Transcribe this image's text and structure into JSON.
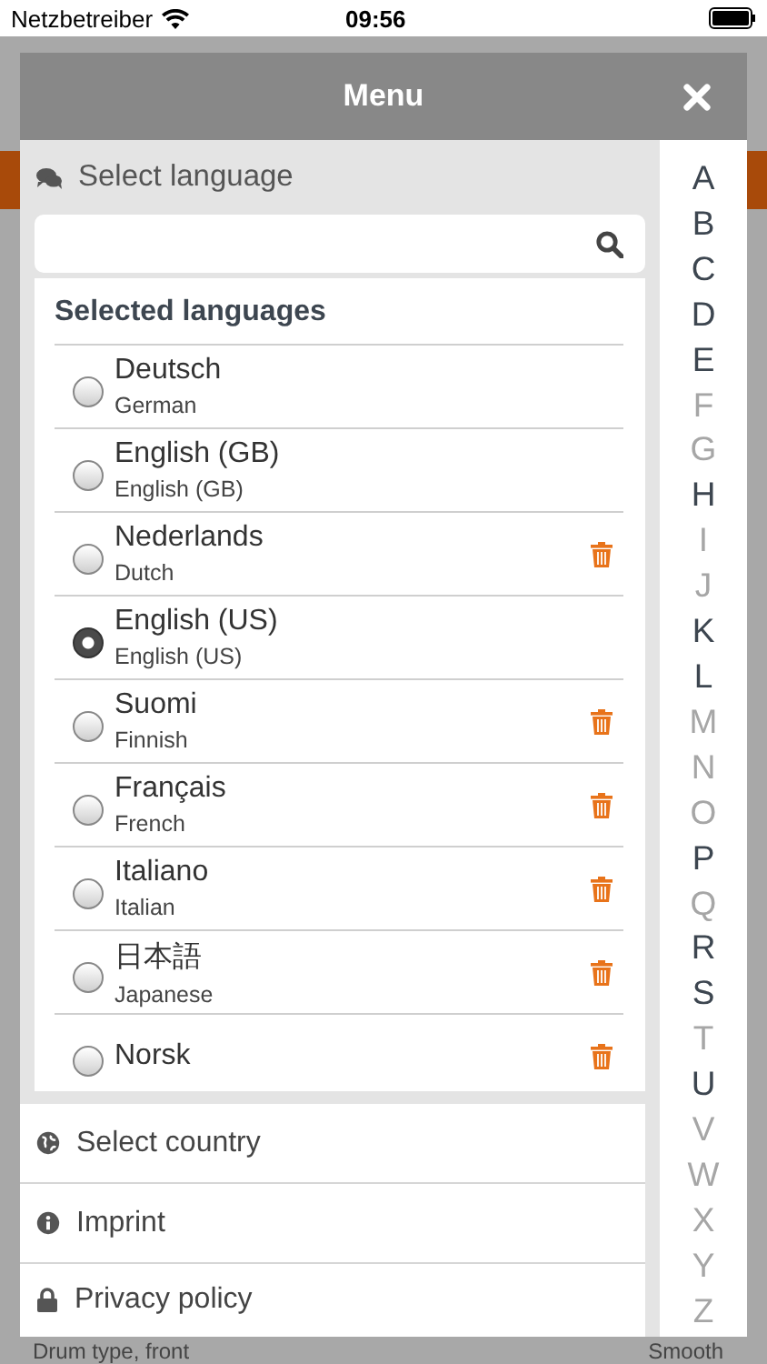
{
  "status_bar": {
    "carrier": "Netzbetreiber",
    "time": "09:56"
  },
  "background": {
    "rows": [
      {
        "label": "Drum type, front",
        "value": "Smooth"
      }
    ]
  },
  "menu": {
    "title": "Menu",
    "language_section": {
      "title": "Select language",
      "selected_heading": "Selected languages",
      "languages": [
        {
          "name": "Deutsch",
          "english": "German",
          "selected": false,
          "deletable": false
        },
        {
          "name": "English (GB)",
          "english": "English (GB)",
          "selected": false,
          "deletable": false
        },
        {
          "name": "Nederlands",
          "english": "Dutch",
          "selected": false,
          "deletable": true
        },
        {
          "name": "English (US)",
          "english": "English (US)",
          "selected": true,
          "deletable": false
        },
        {
          "name": "Suomi",
          "english": "Finnish",
          "selected": false,
          "deletable": true
        },
        {
          "name": "Français",
          "english": "French",
          "selected": false,
          "deletable": true
        },
        {
          "name": "Italiano",
          "english": "Italian",
          "selected": false,
          "deletable": true
        },
        {
          "name": "日本語",
          "english": "Japanese",
          "selected": false,
          "deletable": true
        },
        {
          "name": "Norsk",
          "selected": false,
          "deletable": true
        }
      ]
    },
    "nav_items": [
      {
        "label": "Select country",
        "kind": "globe"
      },
      {
        "label": "Imprint",
        "kind": "info"
      },
      {
        "label": "Privacy policy",
        "kind": "lock"
      }
    ],
    "alphabet": [
      {
        "letter": "A",
        "enabled": true
      },
      {
        "letter": "B",
        "enabled": true
      },
      {
        "letter": "C",
        "enabled": true
      },
      {
        "letter": "D",
        "enabled": true
      },
      {
        "letter": "E",
        "enabled": true
      },
      {
        "letter": "F",
        "enabled": false
      },
      {
        "letter": "G",
        "enabled": false
      },
      {
        "letter": "H",
        "enabled": true
      },
      {
        "letter": "I",
        "enabled": false
      },
      {
        "letter": "J",
        "enabled": false
      },
      {
        "letter": "K",
        "enabled": true
      },
      {
        "letter": "L",
        "enabled": true
      },
      {
        "letter": "M",
        "enabled": false
      },
      {
        "letter": "N",
        "enabled": false
      },
      {
        "letter": "O",
        "enabled": false
      },
      {
        "letter": "P",
        "enabled": true
      },
      {
        "letter": "Q",
        "enabled": false
      },
      {
        "letter": "R",
        "enabled": true
      },
      {
        "letter": "S",
        "enabled": true
      },
      {
        "letter": "T",
        "enabled": false
      },
      {
        "letter": "U",
        "enabled": true
      },
      {
        "letter": "V",
        "enabled": false
      },
      {
        "letter": "W",
        "enabled": false
      },
      {
        "letter": "X",
        "enabled": false
      },
      {
        "letter": "Y",
        "enabled": false
      },
      {
        "letter": "Z",
        "enabled": false
      }
    ]
  }
}
